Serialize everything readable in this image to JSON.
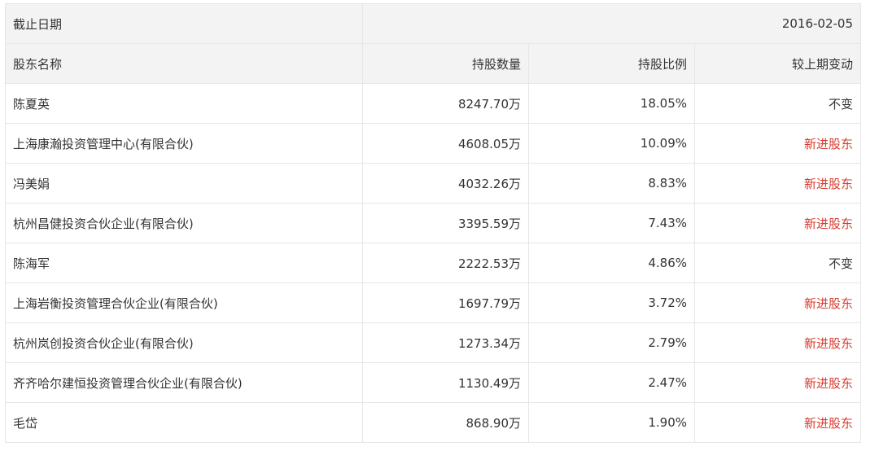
{
  "date_row": {
    "label": "截止日期",
    "value": "2016-02-05"
  },
  "columns": {
    "name": "股东名称",
    "shares": "持股数量",
    "ratio": "持股比例",
    "change": "较上期变动"
  },
  "rows": [
    {
      "name": "陈夏英",
      "shares": "8247.70万",
      "ratio": "18.05%",
      "change": "不变",
      "change_type": "same"
    },
    {
      "name": "上海康瀚投资管理中心(有限合伙)",
      "shares": "4608.05万",
      "ratio": "10.09%",
      "change": "新进股东",
      "change_type": "new"
    },
    {
      "name": "冯美娟",
      "shares": "4032.26万",
      "ratio": "8.83%",
      "change": "新进股东",
      "change_type": "new"
    },
    {
      "name": "杭州昌健投资合伙企业(有限合伙)",
      "shares": "3395.59万",
      "ratio": "7.43%",
      "change": "新进股东",
      "change_type": "new"
    },
    {
      "name": "陈海军",
      "shares": "2222.53万",
      "ratio": "4.86%",
      "change": "不变",
      "change_type": "same"
    },
    {
      "name": "上海岩衡投资管理合伙企业(有限合伙)",
      "shares": "1697.79万",
      "ratio": "3.72%",
      "change": "新进股东",
      "change_type": "new"
    },
    {
      "name": "杭州岚创投资合伙企业(有限合伙)",
      "shares": "1273.34万",
      "ratio": "2.79%",
      "change": "新进股东",
      "change_type": "new"
    },
    {
      "name": "齐齐哈尔建恒投资管理合伙企业(有限合伙)",
      "shares": "1130.49万",
      "ratio": "2.47%",
      "change": "新进股东",
      "change_type": "new"
    },
    {
      "name": "毛岱",
      "shares": "868.90万",
      "ratio": "1.90%",
      "change": "新进股东",
      "change_type": "new"
    }
  ],
  "colors": {
    "header_bg": "#f3f3f3",
    "border": "#e6e6e6",
    "text": "#333333",
    "new_holder_red": "#d83b2e"
  }
}
